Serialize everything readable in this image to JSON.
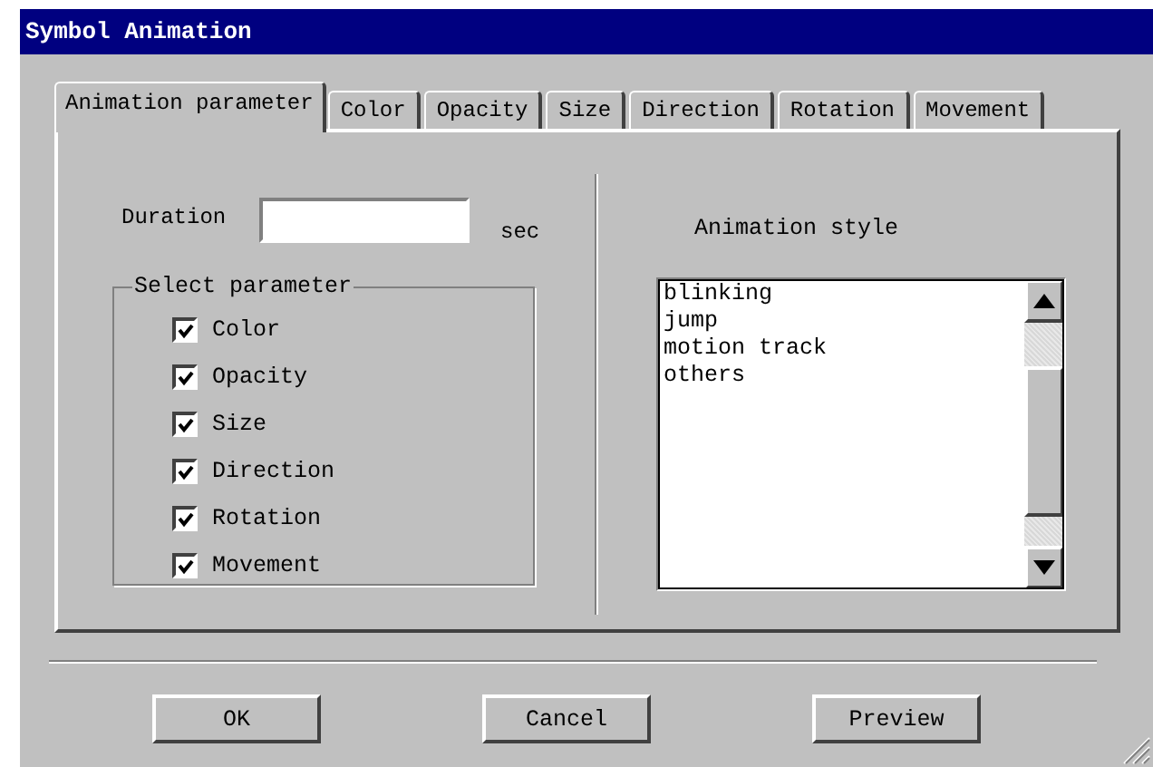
{
  "window": {
    "title": "Symbol Animation"
  },
  "tabs": [
    {
      "label": "Animation parameter",
      "selected": true
    },
    {
      "label": "Color",
      "selected": false
    },
    {
      "label": "Opacity",
      "selected": false
    },
    {
      "label": "Size",
      "selected": false
    },
    {
      "label": "Direction",
      "selected": false
    },
    {
      "label": "Rotation",
      "selected": false
    },
    {
      "label": "Movement",
      "selected": false
    }
  ],
  "duration": {
    "label": "Duration",
    "unit": "sec"
  },
  "select_parameter": {
    "title": "Select parameter",
    "items": [
      {
        "label": "Color",
        "checked": true
      },
      {
        "label": "Opacity",
        "checked": true
      },
      {
        "label": "Size",
        "checked": true
      },
      {
        "label": "Direction",
        "checked": true
      },
      {
        "label": "Rotation",
        "checked": true
      },
      {
        "label": "Movement",
        "checked": true
      }
    ]
  },
  "animation_style": {
    "label": "Animation style",
    "items": [
      {
        "label": "blinking",
        "selected": false
      },
      {
        "label": "jump",
        "selected": false
      },
      {
        "label": "motion track",
        "selected": false
      },
      {
        "label": "others",
        "selected": false
      }
    ]
  },
  "buttons": [
    "OK",
    "Cancel",
    "Preview"
  ]
}
